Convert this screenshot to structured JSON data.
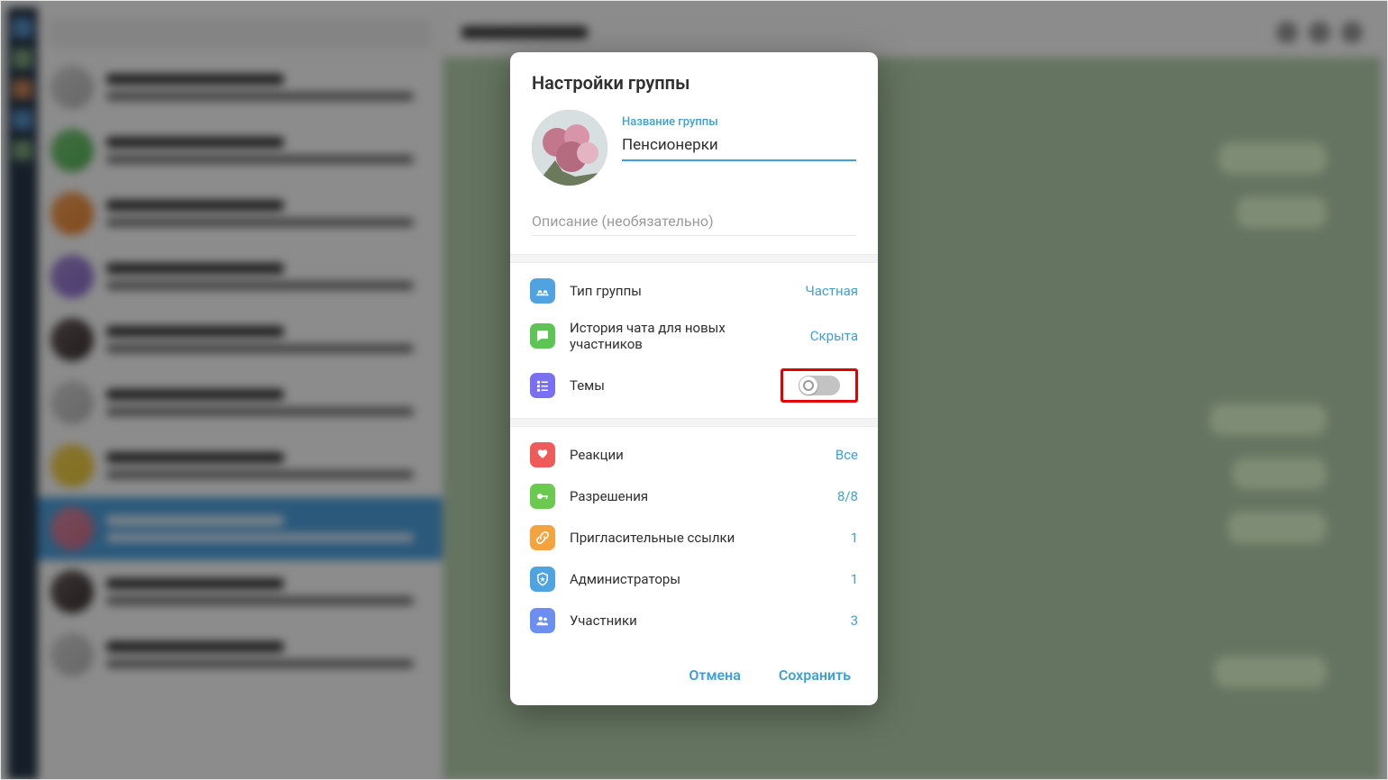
{
  "modal": {
    "title": "Настройки группы",
    "name_label": "Название группы",
    "group_name": "Пенсионерки",
    "description_placeholder": "Описание (необязательно)",
    "section1": {
      "type_label": "Тип группы",
      "type_value": "Частная",
      "history_label": "История чата для новых участников",
      "history_value": "Скрыта",
      "topics_label": "Темы"
    },
    "section2": {
      "reactions_label": "Реакции",
      "reactions_value": "Все",
      "permissions_label": "Разрешения",
      "permissions_value": "8/8",
      "links_label": "Пригласительные ссылки",
      "links_value": "1",
      "admins_label": "Администраторы",
      "admins_value": "1",
      "members_label": "Участники",
      "members_value": "3"
    },
    "actions": {
      "cancel": "Отмена",
      "save": "Сохранить"
    }
  }
}
